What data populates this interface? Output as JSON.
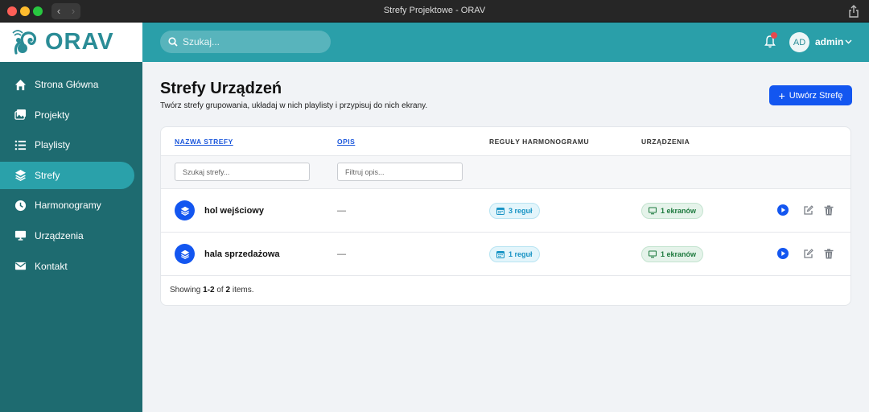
{
  "window": {
    "title": "Strefy Projektowe - ORAV"
  },
  "brand": {
    "name": "ORAV",
    "color": "#2a8c96"
  },
  "sidebar": {
    "items": [
      {
        "label": "Strona Główna",
        "icon": "home-icon",
        "active": false
      },
      {
        "label": "Projekty",
        "icon": "images-icon",
        "active": false
      },
      {
        "label": "Playlisty",
        "icon": "list-icon",
        "active": false
      },
      {
        "label": "Strefy",
        "icon": "layers-icon",
        "active": true
      },
      {
        "label": "Harmonogramy",
        "icon": "clock-icon",
        "active": false
      },
      {
        "label": "Urządzenia",
        "icon": "monitor-icon",
        "active": false
      },
      {
        "label": "Kontakt",
        "icon": "envelope-icon",
        "active": false
      }
    ]
  },
  "topbar": {
    "search_placeholder": "Szukaj...",
    "user": {
      "initials": "AD",
      "name": "admin"
    },
    "notification_badge": true
  },
  "page": {
    "title": "Strefy Urządzeń",
    "subtitle": "Twórz strefy grupowania, układaj w nich playlisty i przypisuj do nich ekrany.",
    "create_label": "Utwórz Strefę"
  },
  "table": {
    "columns": {
      "name": "NAZWA STREFY",
      "desc": "OPIS",
      "rules": "REGUŁY HARMONOGRAMU",
      "devices": "URZĄDZENIA"
    },
    "filters": {
      "name_placeholder": "Szukaj strefy...",
      "desc_placeholder": "Filtruj opis..."
    },
    "rows": [
      {
        "name": "hol wejściowy",
        "desc": "—",
        "rules": "3 reguł",
        "devices": "1 ekranów"
      },
      {
        "name": "hala sprzedażowa",
        "desc": "—",
        "rules": "1 reguł",
        "devices": "1 ekranów"
      }
    ],
    "summary": {
      "prefix": "Showing ",
      "range": "1-2",
      "mid": " of ",
      "total": "2",
      "suffix": " items."
    }
  },
  "colors": {
    "sidebar": "#1e6b70",
    "topbar": "#2a9fa9",
    "primary": "#1356f0"
  }
}
